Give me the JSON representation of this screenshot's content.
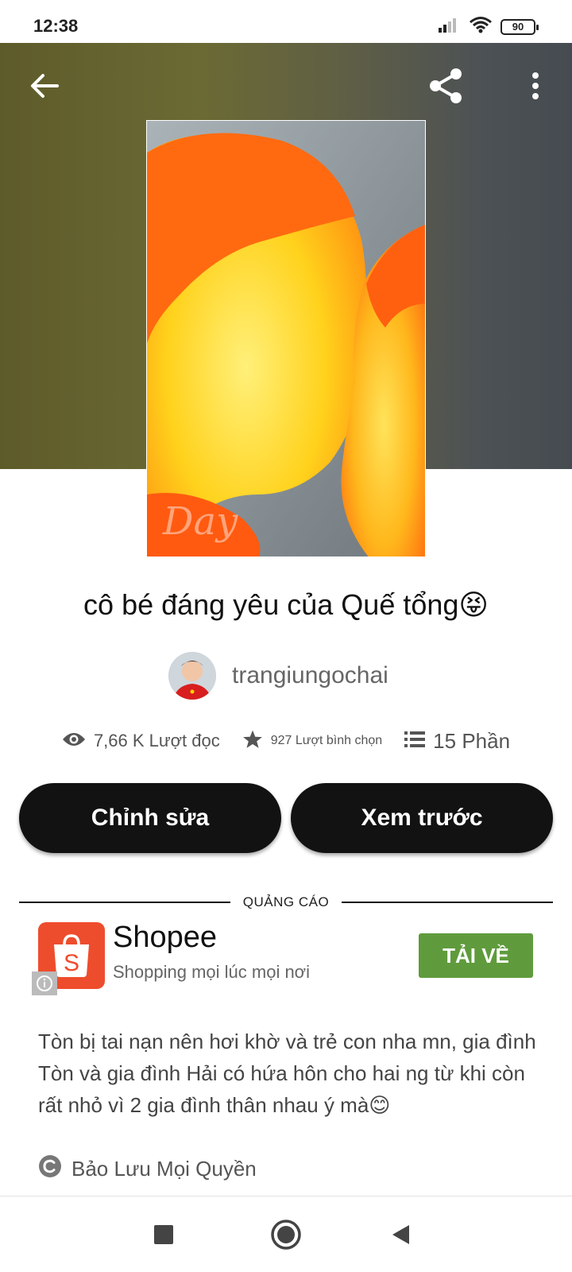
{
  "status_bar": {
    "time": "12:38",
    "battery": "90",
    "icons": [
      "signal-icon",
      "wifi-icon",
      "battery-icon"
    ]
  },
  "header": {
    "icons": [
      "back-arrow-icon",
      "share-icon",
      "more-vertical-icon"
    ]
  },
  "story": {
    "title": "cô bé đáng yêu của Quế tổng😝",
    "author": "trangiungochai",
    "stats": {
      "reads": "7,66 K Lượt đọc",
      "votes": "927 Lượt bình chọn",
      "parts": "15 Phần"
    },
    "description": "Tòn bị tai nạn nên hơi khờ và trẻ con nha mn, gia đình Tòn và gia đình Hải có hứa hôn cho hai ng từ khi còn rất nhỏ vì 2 gia đình thân nhau ý mà😊",
    "copyright": "Bảo Lưu Mọi Quyền"
  },
  "actions": {
    "edit_label": "Chỉnh sửa",
    "preview_label": "Xem trước"
  },
  "ad": {
    "label": "QUẢNG CÁO",
    "name": "Shopee",
    "tagline": "Shopping mọi lúc mọi nơi",
    "cta": "TẢI VỀ",
    "brand_color": "#ee4d2d",
    "cta_color": "#5f9b3c"
  },
  "nav_bar": {
    "icons": [
      "recents-square-icon",
      "home-circle-icon",
      "back-triangle-icon"
    ]
  }
}
